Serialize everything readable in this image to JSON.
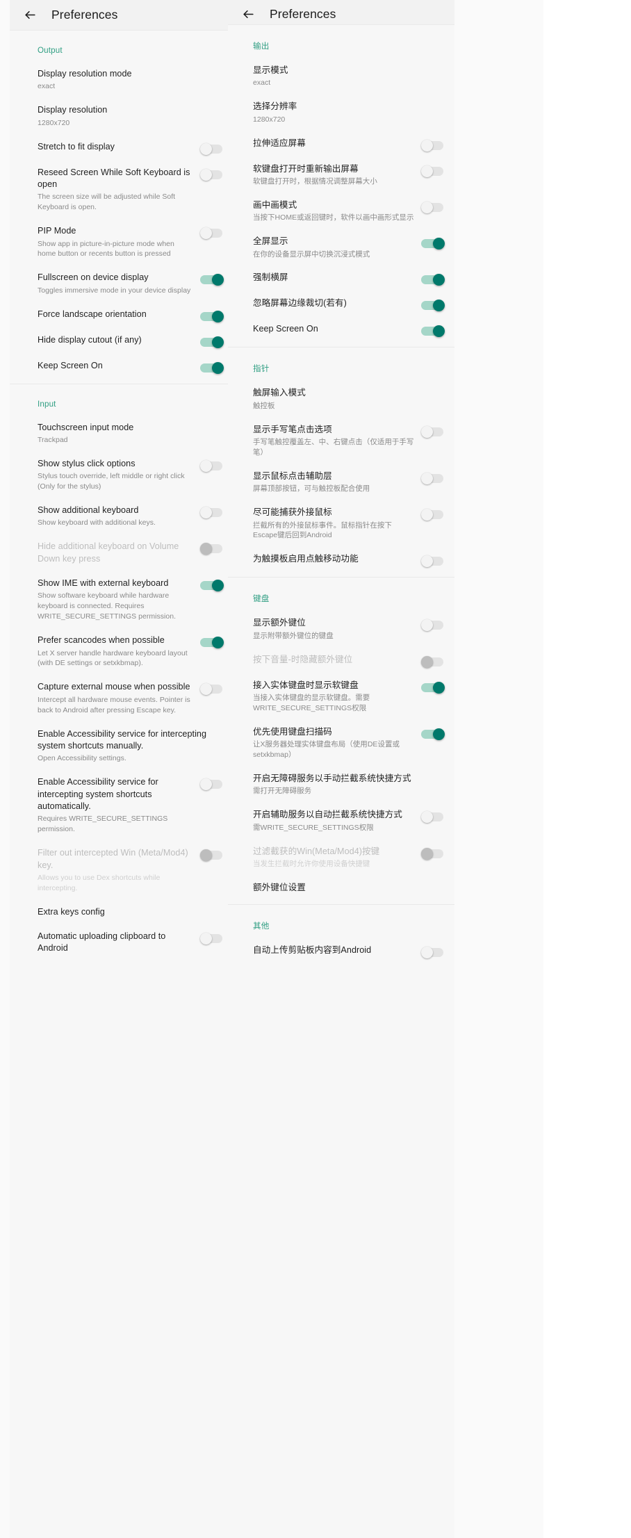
{
  "appbar": {
    "title": "Preferences",
    "back_icon": "arrow-left-icon"
  },
  "left_panel": {
    "lang": "en",
    "title": "Preferences",
    "sections": [
      {
        "header": "Output",
        "rows": [
          {
            "title": "Display resolution mode",
            "sub": "exact",
            "control": "none"
          },
          {
            "title": "Display resolution",
            "sub": "1280x720",
            "control": "none"
          },
          {
            "title": "Stretch to fit display",
            "sub": "",
            "control": "switch",
            "state": "off"
          },
          {
            "title": "Reseed Screen While Soft Keyboard is open",
            "sub": "The screen size will be adjusted while Soft Keyboard is open.",
            "control": "switch",
            "state": "off"
          },
          {
            "title": "PIP Mode",
            "sub": "Show app in picture-in-picture mode when home button or recents button is pressed",
            "control": "switch",
            "state": "off"
          },
          {
            "title": "Fullscreen on device display",
            "sub": "Toggles immersive mode in your device display",
            "control": "switch",
            "state": "on"
          },
          {
            "title": "Force landscape orientation",
            "sub": "",
            "control": "switch",
            "state": "on"
          },
          {
            "title": "Hide display cutout (if any)",
            "sub": "",
            "control": "switch",
            "state": "on"
          },
          {
            "title": "Keep Screen On",
            "sub": "",
            "control": "switch",
            "state": "on"
          }
        ]
      },
      {
        "header": "Input",
        "rows": [
          {
            "title": "Touchscreen input mode",
            "sub": "Trackpad",
            "control": "none"
          },
          {
            "title": "Show stylus click options",
            "sub": "Stylus touch override, left middle or right click (Only for the stylus)",
            "control": "switch",
            "state": "off"
          },
          {
            "title": "Show additional keyboard",
            "sub": "Show keyboard with additional keys.",
            "control": "switch",
            "state": "off"
          },
          {
            "title": "Hide additional keyboard on Volume Down key press",
            "sub": "",
            "control": "switch",
            "state": "off",
            "disabled": true
          },
          {
            "title": "Show IME with external keyboard",
            "sub": "Show software keyboard while hardware keyboard is connected. Requires WRITE_SECURE_SETTINGS permission.",
            "control": "switch",
            "state": "on"
          },
          {
            "title": "Prefer scancodes when possible",
            "sub": "Let X server handle hardware keyboard layout (with DE settings or setxkbmap).",
            "control": "switch",
            "state": "on"
          },
          {
            "title": "Capture external mouse when possible",
            "sub": "Intercept all hardware mouse events. Pointer is back to Android after pressing Escape key.",
            "control": "switch",
            "state": "off"
          },
          {
            "title": "Enable Accessibility service for intercepting system shortcuts manually.",
            "sub": "Open Accessibility settings.",
            "control": "none"
          },
          {
            "title": "Enable Accessibility service for intercepting system shortcuts automatically.",
            "sub": "Requires WRITE_SECURE_SETTINGS permission.",
            "control": "switch",
            "state": "off"
          },
          {
            "title": "Filter out intercepted Win (Meta/Mod4) key.",
            "sub": "Allows you to use Dex shortcuts while intercepting.",
            "control": "switch",
            "state": "off",
            "disabled": true
          },
          {
            "title": "Extra keys config",
            "sub": "",
            "control": "none"
          },
          {
            "title": "Automatic uploading clipboard to Android",
            "sub": "",
            "control": "switch",
            "state": "off"
          }
        ]
      }
    ]
  },
  "right_panel": {
    "lang": "zh",
    "title": "Preferences",
    "sections": [
      {
        "header": "输出",
        "rows": [
          {
            "title": "显示模式",
            "sub": "exact",
            "control": "none"
          },
          {
            "title": "选择分辨率",
            "sub": "1280x720",
            "control": "none"
          },
          {
            "title": "拉伸适应屏幕",
            "sub": "",
            "control": "switch",
            "state": "off"
          },
          {
            "title": "软键盘打开时重新输出屏幕",
            "sub": "软键盘打开时，根据情况调整屏幕大小",
            "control": "switch",
            "state": "off"
          },
          {
            "title": "画中画模式",
            "sub": "当按下HOME或返回键时，软件以画中画形式显示",
            "control": "switch",
            "state": "off"
          },
          {
            "title": "全屏显示",
            "sub": "在你的设备显示屏中切换沉浸式模式",
            "control": "switch",
            "state": "on"
          },
          {
            "title": "强制横屏",
            "sub": "",
            "control": "switch",
            "state": "on"
          },
          {
            "title": "忽略屏幕边缘裁切(若有)",
            "sub": "",
            "control": "switch",
            "state": "on"
          },
          {
            "title": "Keep Screen On",
            "sub": "",
            "control": "switch",
            "state": "on"
          }
        ]
      },
      {
        "header": "指针",
        "rows": [
          {
            "title": "触屏输入模式",
            "sub": "触控板",
            "control": "none"
          },
          {
            "title": "显示手写笔点击选项",
            "sub": "手写笔触控覆盖左、中、右键点击（仅适用于手写笔）",
            "control": "switch",
            "state": "off"
          },
          {
            "title": "显示鼠标点击辅助层",
            "sub": "屏幕顶部按钮，可与触控板配合使用",
            "control": "switch",
            "state": "off"
          },
          {
            "title": "尽可能捕获外接鼠标",
            "sub": "拦截所有的外接鼠标事件。鼠标指针在按下Escape键后回到Android",
            "control": "switch",
            "state": "off"
          },
          {
            "title": "为触摸板启用点触移动功能",
            "sub": "",
            "control": "switch",
            "state": "off"
          }
        ]
      },
      {
        "header": "键盘",
        "rows": [
          {
            "title": "显示额外键位",
            "sub": "显示附带额外键位的键盘",
            "control": "switch",
            "state": "off"
          },
          {
            "title": "按下音量-时隐藏额外键位",
            "sub": "",
            "control": "switch",
            "state": "off",
            "disabled": true
          },
          {
            "title": "接入实体键盘时显示软键盘",
            "sub": "当接入实体键盘的显示软键盘。需要WRITE_SECURE_SETTINGS权限",
            "control": "switch",
            "state": "on"
          },
          {
            "title": "优先使用键盘扫描码",
            "sub": "让X服务器处理实体键盘布局（使用DE设置或setxkbmap）",
            "control": "switch",
            "state": "on"
          },
          {
            "title": "开启无障碍服务以手动拦截系统快捷方式",
            "sub": "需打开无障碍服务",
            "control": "none"
          },
          {
            "title": "开启辅助服务以自动拦截系统快捷方式",
            "sub": "需WRITE_SECURE_SETTINGS权限",
            "control": "switch",
            "state": "off"
          },
          {
            "title": "过滤截获的Win(Meta/Mod4)按键",
            "sub": "当发生拦截时允许你使用设备快捷键",
            "control": "switch",
            "state": "off",
            "disabled": true
          },
          {
            "title": "额外键位设置",
            "sub": "",
            "control": "none"
          }
        ]
      },
      {
        "header": "其他",
        "rows": [
          {
            "title": "自动上传剪贴板内容到Android",
            "sub": "",
            "control": "switch",
            "state": "off"
          }
        ]
      }
    ]
  }
}
